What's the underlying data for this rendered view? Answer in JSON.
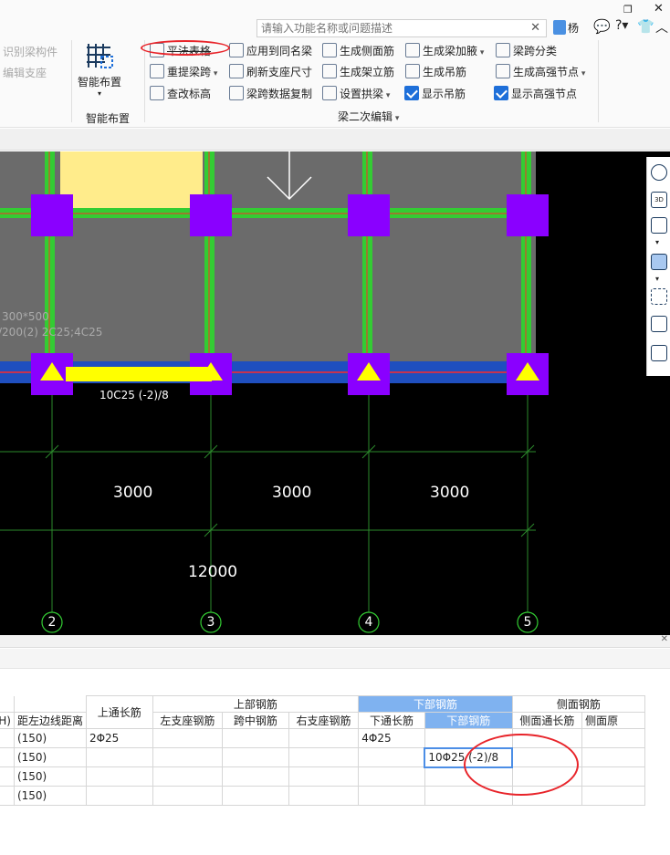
{
  "window": {
    "restore_icon": "restore-window-icon",
    "close_icon": "close-window-icon",
    "user_name": "杨"
  },
  "search": {
    "placeholder": "请输入功能名称或问题描述"
  },
  "ribbon": {
    "left_items": [
      "识别梁构件",
      "编辑支座"
    ],
    "smart_layout_label": "智能布置",
    "smart_layout_group": "智能布置",
    "items": [
      {
        "label": "平法表格",
        "icon": "table-icon"
      },
      {
        "label": "应用到同名梁",
        "icon": "apply-icon"
      },
      {
        "label": "生成侧面筋",
        "icon": "side-rebar-icon"
      },
      {
        "label": "生成梁加腋",
        "icon": "haunch-icon",
        "dropdown": true
      },
      {
        "label": "梁跨分类",
        "icon": "span-classify-icon"
      },
      {
        "label": "重提梁跨",
        "icon": "re-extract-icon",
        "dropdown": true
      },
      {
        "label": "刷新支座尺寸",
        "icon": "refresh-icon"
      },
      {
        "label": "生成架立筋",
        "icon": "erect-rebar-icon"
      },
      {
        "label": "生成吊筋",
        "icon": "hanger-icon"
      },
      {
        "label": "生成高强节点",
        "icon": "high-strength-icon",
        "dropdown": true
      },
      {
        "label": "查改标高",
        "icon": "elevation-icon"
      },
      {
        "label": "梁跨数据复制",
        "icon": "copy-span-icon"
      },
      {
        "label": "设置拱梁",
        "icon": "arch-beam-icon",
        "dropdown": true
      },
      {
        "label": "显示吊筋",
        "checked": true
      },
      {
        "label": "显示高强节点",
        "checked": true
      }
    ],
    "group_label": "梁二次编辑"
  },
  "canvas": {
    "beam_text_1": "300*500",
    "beam_text_2": "/200(2) 2C25;4C25",
    "rebar_label": "10C25 (-2)/8",
    "dims": [
      "3000",
      "3000",
      "3000"
    ],
    "total_dim": "12000",
    "axes": [
      "2",
      "3",
      "4",
      "5"
    ],
    "colors": {
      "beam": "#33cc33",
      "column": "#8a00ff",
      "support": "#ffff00",
      "highlight": "#ffec8b"
    }
  },
  "right_toolbar": [
    "sphere-icon",
    "3d-view-icon",
    "cube-icon",
    "box-icon",
    "fullscreen-icon",
    "component-icon",
    "layer-view-icon"
  ],
  "table": {
    "group_headers": {
      "top": "上部钢筋",
      "bottom": "下部钢筋",
      "side": "侧面钢筋"
    },
    "headers": [
      "H)",
      "距左边线距离",
      "上通长筋",
      "左支座钢筋",
      "跨中钢筋",
      "右支座钢筋",
      "下通长筋",
      "下部钢筋",
      "侧面通长筋",
      "侧面原"
    ],
    "rows": [
      [
        "(150)",
        "2Φ25",
        "",
        "",
        "",
        "4Φ25",
        "",
        "",
        ""
      ],
      [
        "(150)",
        "",
        "",
        "",
        "",
        "",
        "10Φ25 (-2)/8",
        "",
        ""
      ],
      [
        "(150)",
        "",
        "",
        "",
        "",
        "",
        "",
        "",
        ""
      ],
      [
        "(150)",
        "",
        "",
        "",
        "",
        "",
        "",
        "",
        ""
      ]
    ]
  }
}
